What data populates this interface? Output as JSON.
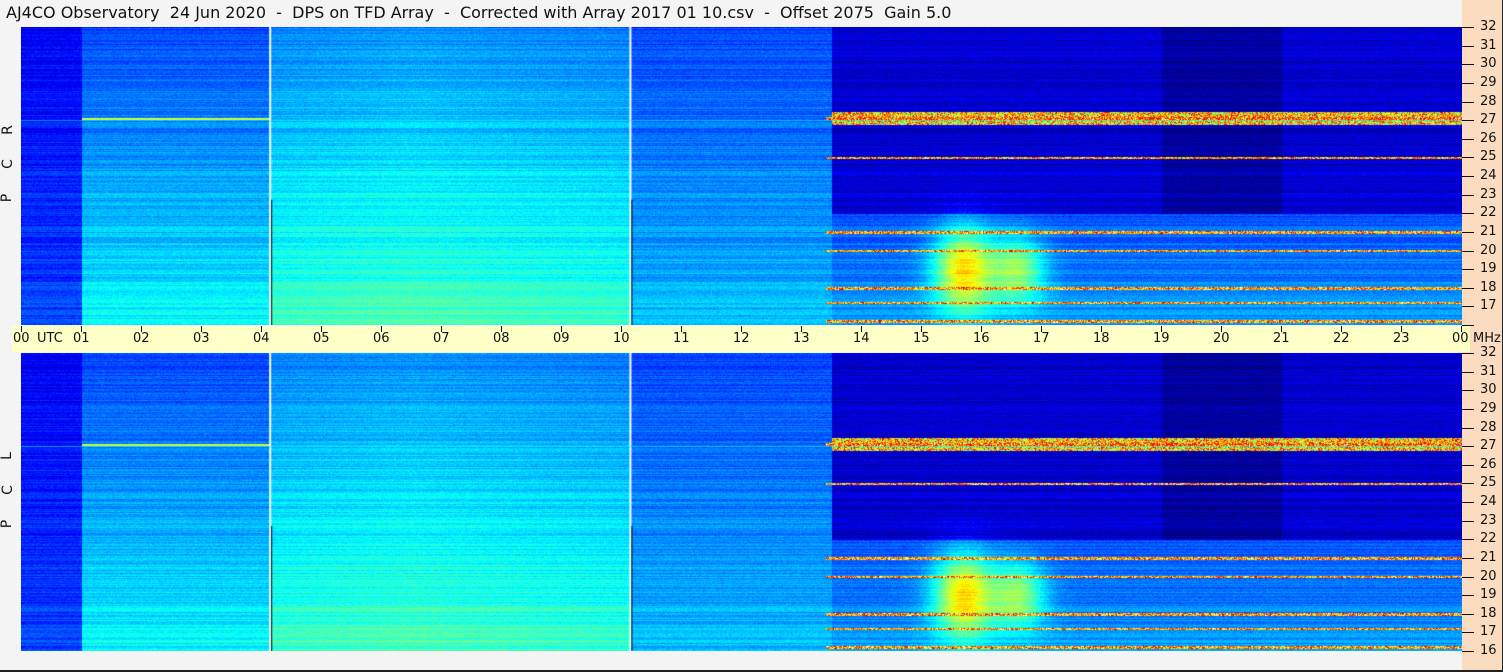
{
  "chart_data": {
    "type": "heatmap",
    "title": "AJ4CO Observatory  24 Jun 2020  -  DPS on TFD Array  -  Corrected with Array 2017 01 10.csv  -  Offset 2075  Gain 5.0",
    "xlabel": "UTC",
    "ylabel": "MHz",
    "x_ticks": [
      "00",
      "01",
      "02",
      "03",
      "04",
      "05",
      "06",
      "07",
      "08",
      "09",
      "10",
      "11",
      "12",
      "13",
      "14",
      "15",
      "16",
      "17",
      "18",
      "19",
      "20",
      "21",
      "22",
      "23",
      "00"
    ],
    "y_ticks": [
      "32",
      "31",
      "30",
      "29",
      "28",
      "27",
      "26",
      "25",
      "24",
      "23",
      "22",
      "21",
      "20",
      "19",
      "18",
      "17",
      "16"
    ],
    "xlim_hours": [
      0,
      24
    ],
    "ylim_mhz": [
      16,
      32
    ],
    "panels": [
      {
        "label": "R C P",
        "letters": [
          "R",
          "C",
          "P"
        ]
      },
      {
        "label": "L C P",
        "letters": [
          "L",
          "C",
          "P"
        ]
      }
    ],
    "colormap": "jet",
    "features": {
      "rfi_lines_mhz": [
        27.1,
        25,
        21,
        20,
        18,
        17.2,
        16.2
      ],
      "burst_hours": [
        15.2,
        16.9
      ],
      "burst_mhz": [
        17,
        22
      ],
      "vertical_markers_hours": [
        4.15,
        10.15
      ]
    }
  },
  "colors": {
    "axis_bg": "#fcdcc0",
    "time_band": "#ffffc8"
  }
}
